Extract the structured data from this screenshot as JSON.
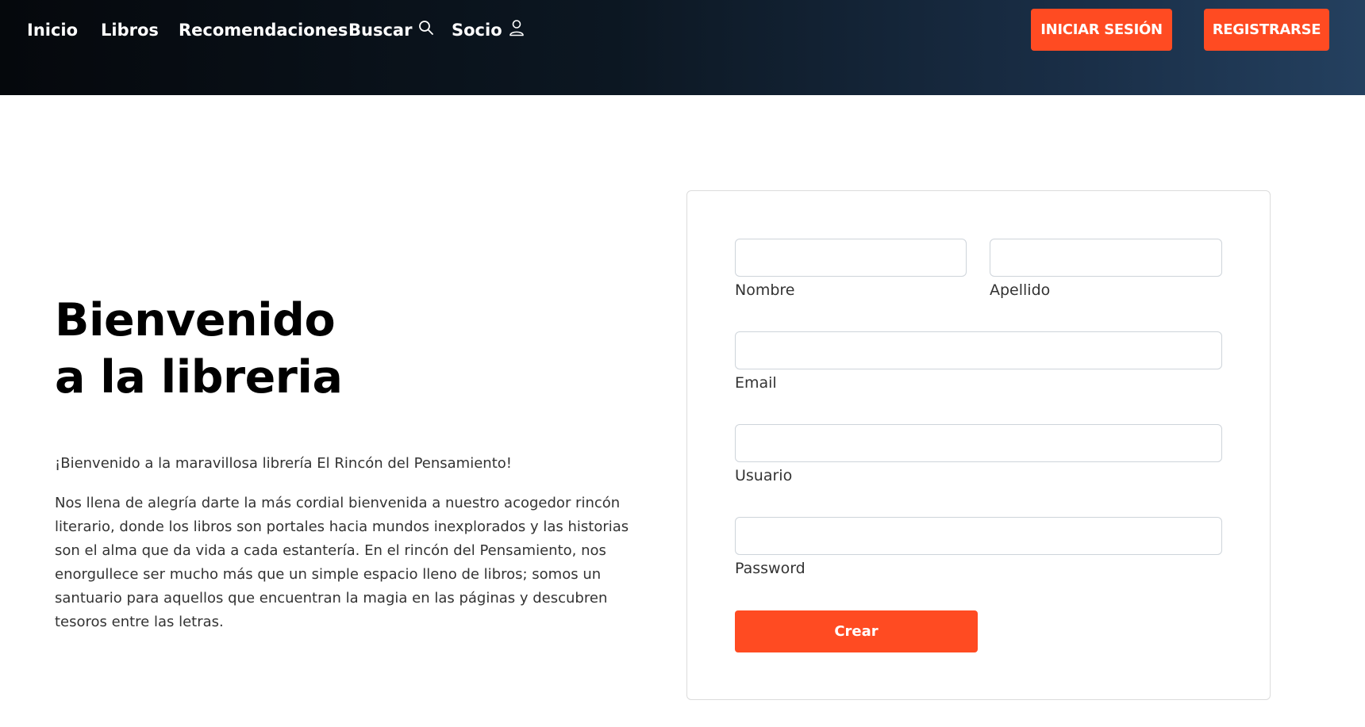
{
  "nav": {
    "links": [
      {
        "label": "Inicio"
      },
      {
        "label": "Libros"
      },
      {
        "label": "Recomendaciones"
      },
      {
        "label": "Buscar",
        "icon": "search-icon"
      },
      {
        "label": "Socio",
        "icon": "user-icon"
      }
    ],
    "login_label": "INICIAR SESIÓN",
    "register_label": "REGISTRARSE"
  },
  "hero": {
    "title_line1": "Bienvenido",
    "title_line2": "a la libreria",
    "intro": "¡Bienvenido a la maravillosa librería El Rincón del Pensamiento!",
    "body_lines": [
      "Nos llena de alegría darte la más cordial bienvenida a nuestro acogedor rincón",
      "literario, donde los libros son portales hacia mundos inexplorados y las historias",
      "son el alma que da vida a cada estantería. En el rincón del Pensamiento, nos",
      "enorgullece ser mucho más que un simple espacio lleno de libros; somos un",
      "santuario para aquellos que encuentran la magia en las páginas y descubren",
      "tesoros entre las letras."
    ]
  },
  "form": {
    "nombre": {
      "label": "Nombre",
      "value": ""
    },
    "apellido": {
      "label": "Apellido",
      "value": ""
    },
    "email": {
      "label": "Email",
      "value": ""
    },
    "usuario": {
      "label": "Usuario",
      "value": ""
    },
    "password": {
      "label": "Password",
      "value": ""
    },
    "submit_label": "Crear"
  },
  "colors": {
    "accent": "#ff4b22",
    "nav_dark": "#05080c",
    "nav_light": "#24405f"
  }
}
